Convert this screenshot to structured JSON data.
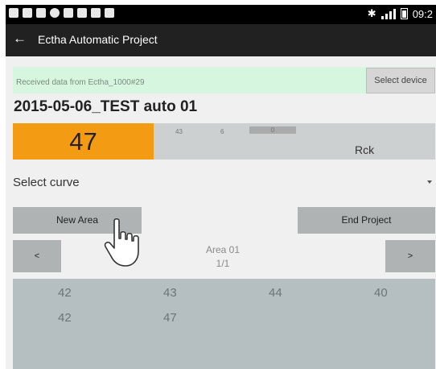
{
  "statusbar": {
    "time": "09:2"
  },
  "appbar": {
    "back_glyph": "←",
    "title": "Ectha Automatic Project"
  },
  "info": {
    "message": "Received data from Ectha_1000#29",
    "select_device_label": "Select device"
  },
  "project": {
    "name": "2015-05-06_TEST auto 01"
  },
  "reading": {
    "value": "47",
    "mini_values": [
      "43",
      "6",
      "0"
    ],
    "unit": "Rck",
    "accent_color": "#f39b13"
  },
  "curve": {
    "selected": "Select curve"
  },
  "buttons": {
    "new_area": "New Area",
    "end_project": "End Project",
    "prev": "<",
    "next": ">"
  },
  "area": {
    "name": "Area 01",
    "page": "1/1"
  },
  "readings_grid": [
    [
      "42",
      "43",
      "44",
      "40"
    ],
    [
      "42",
      "47"
    ]
  ]
}
